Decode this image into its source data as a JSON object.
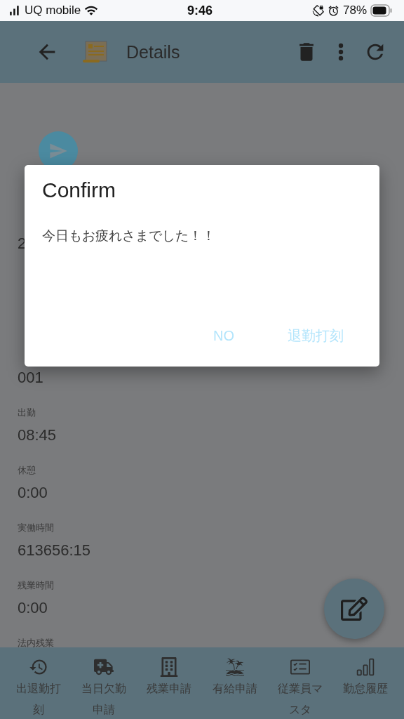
{
  "status_bar": {
    "carrier": "UQ mobile",
    "time": "9:46",
    "battery": "78%"
  },
  "app_bar": {
    "title": "Details"
  },
  "fields": [
    {
      "value": "2"
    },
    {
      "value": "001"
    },
    {
      "label": "出勤",
      "value": "08:45"
    },
    {
      "label": "休憩",
      "value": "0:00"
    },
    {
      "label": "実働時間",
      "value": "613656:15"
    },
    {
      "label": "残業時間",
      "value": "0:00"
    },
    {
      "label": "法内残業"
    }
  ],
  "dialog": {
    "title": "Confirm",
    "message": "今日もお疲れさまでした！！",
    "buttons": [
      "NO",
      "退勤打刻"
    ]
  },
  "bottom_nav": [
    {
      "label": "出退勤打刻"
    },
    {
      "label": "当日欠勤申請"
    },
    {
      "label": "残業申請"
    },
    {
      "label": "有給申請"
    },
    {
      "label": "従業員マスタ"
    },
    {
      "label": "勤怠履歴"
    }
  ]
}
